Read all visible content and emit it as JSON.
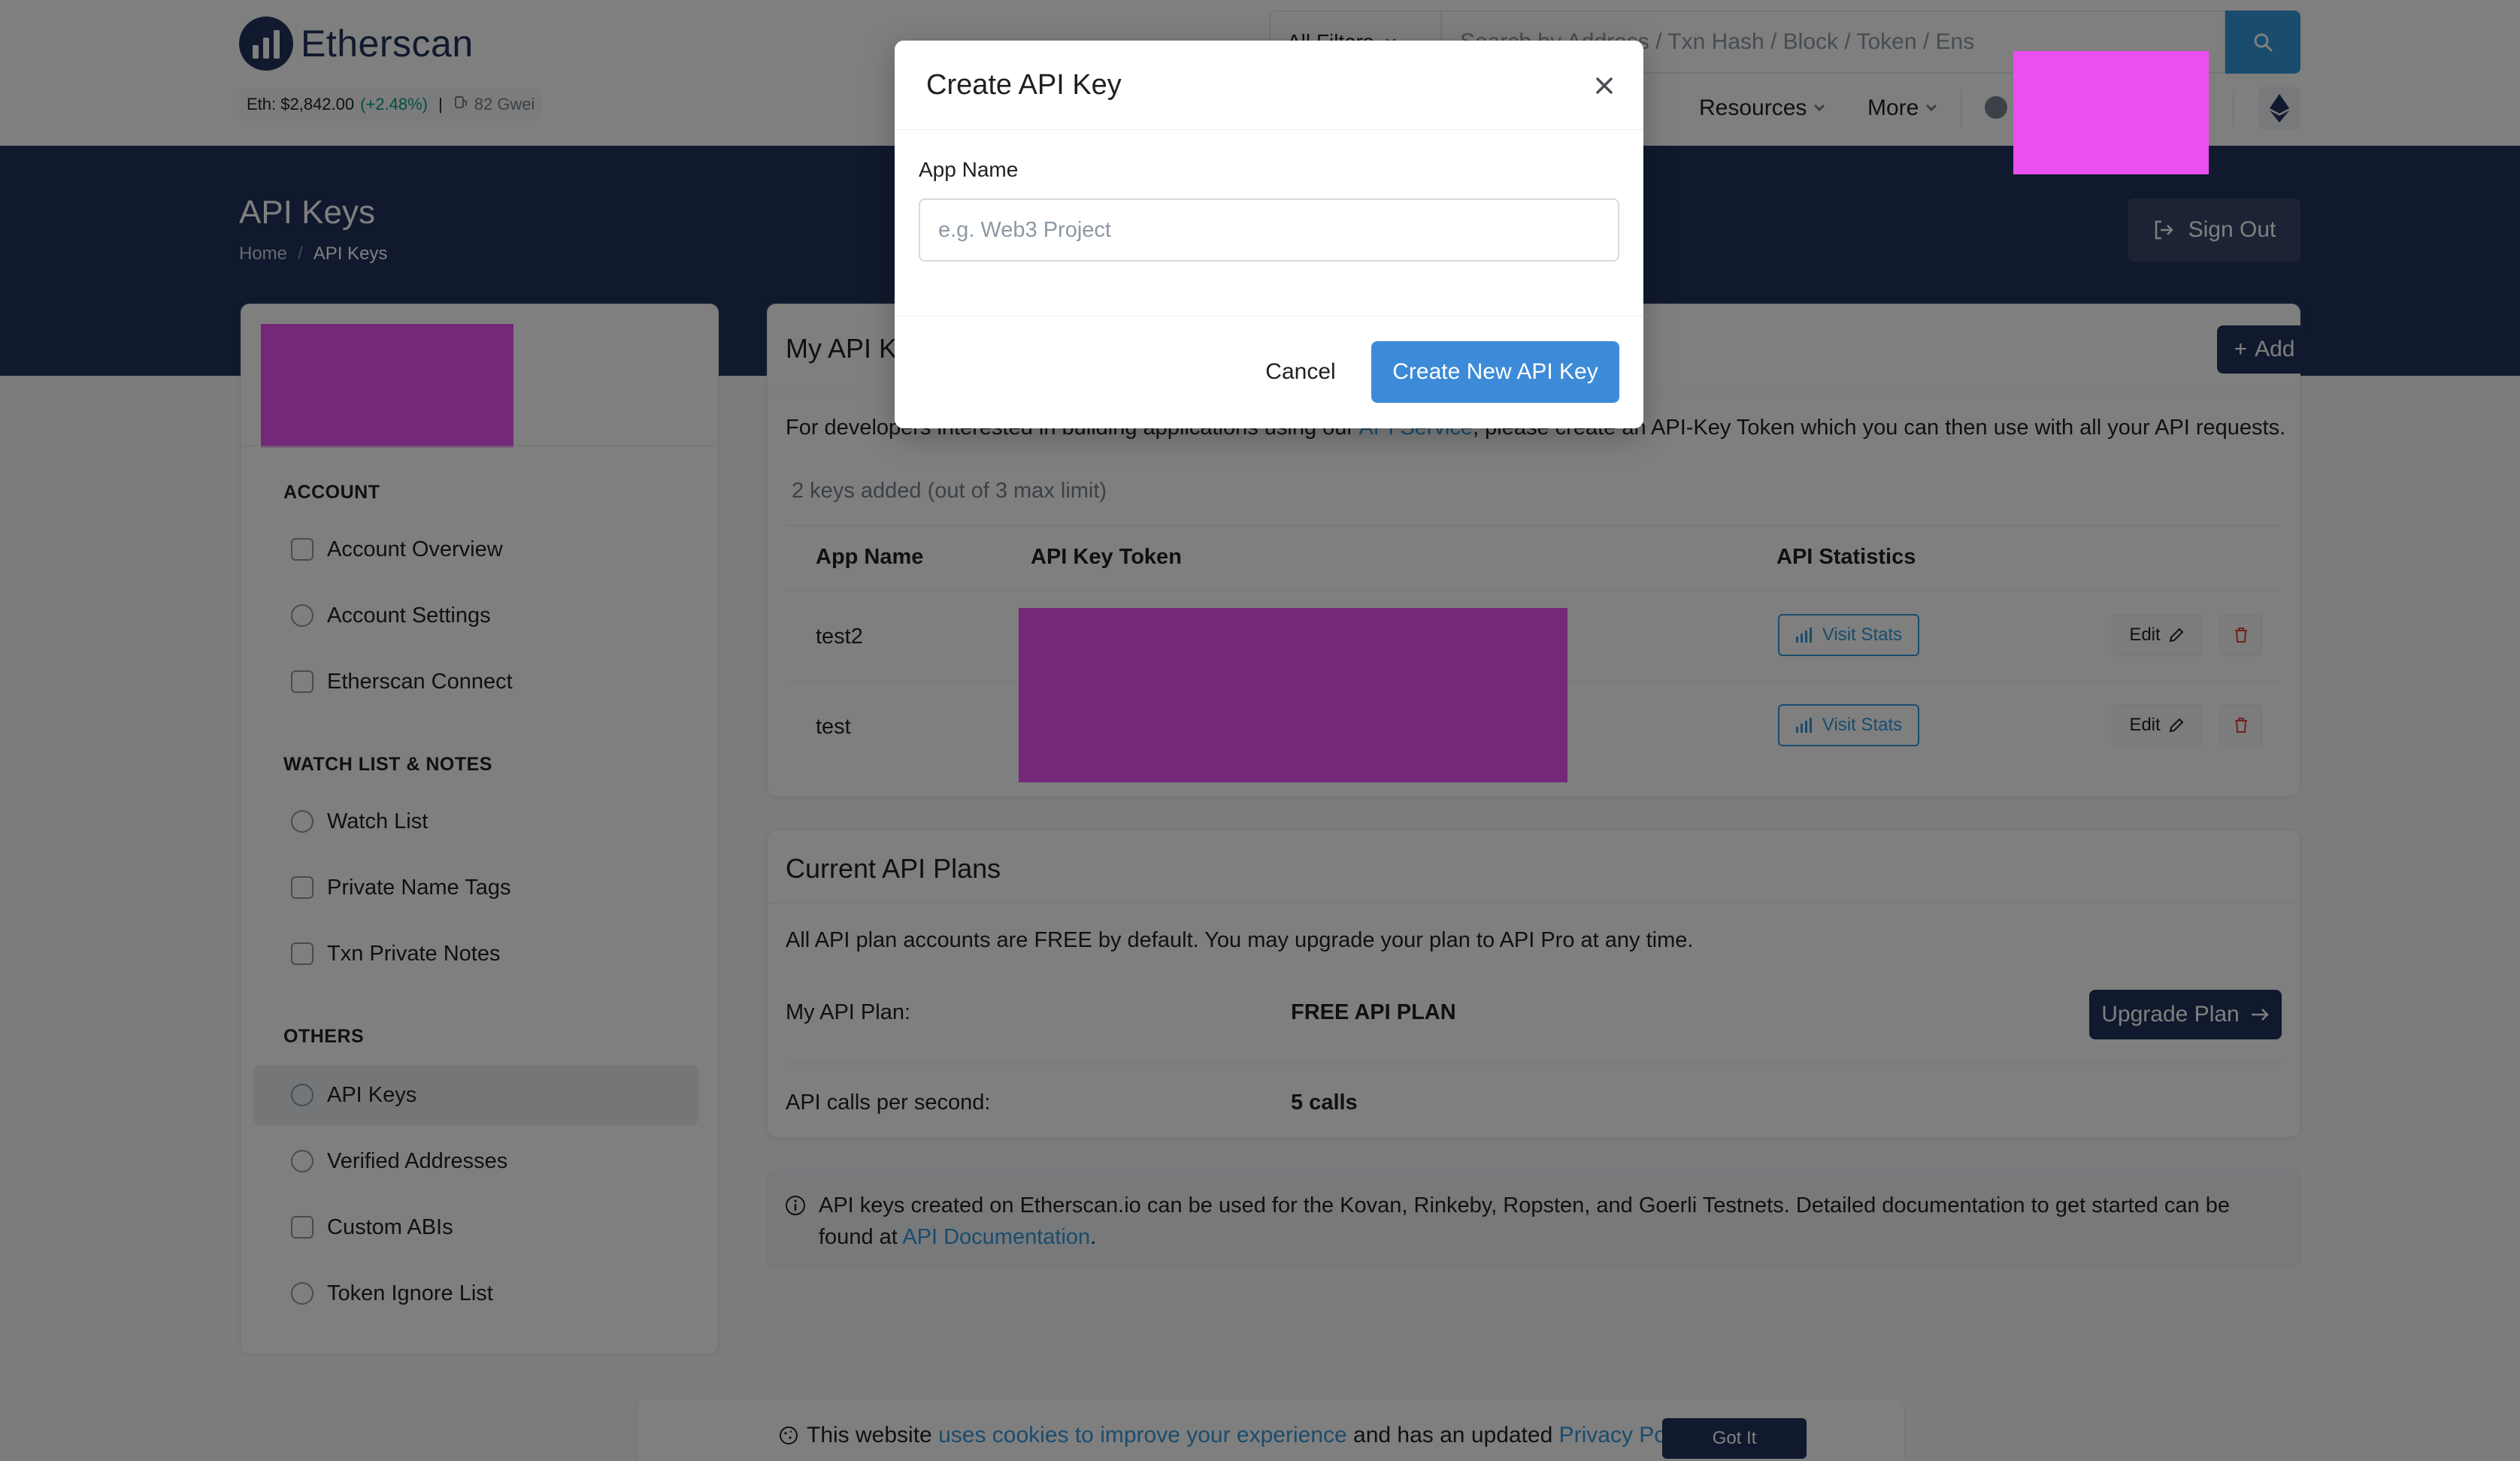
{
  "header": {
    "logo_text": "Etherscan",
    "eth_price_label": "Eth: $2,842.00",
    "eth_change": "(+2.48%)",
    "separator": "|",
    "gas": "82 Gwei",
    "filter_label": "All Filters",
    "search_placeholder": "Search by Address / Txn Hash / Block / Token / Ens",
    "nav": {
      "resources": "Resources",
      "more": "More"
    }
  },
  "hero": {
    "title": "API Keys",
    "breadcrumb_home": "Home",
    "breadcrumb_sep": "/",
    "breadcrumb_current": "API Keys",
    "sign_out": "Sign Out"
  },
  "sidebar": {
    "sections": [
      {
        "title": "ACCOUNT"
      },
      {
        "title": "WATCH LIST & NOTES"
      },
      {
        "title": "OTHERS"
      }
    ],
    "items": [
      {
        "label": "Account Overview",
        "icon": "home-icon"
      },
      {
        "label": "Account Settings",
        "icon": "user-settings-icon"
      },
      {
        "label": "Etherscan Connect",
        "icon": "gift-icon"
      },
      {
        "label": "Watch List",
        "icon": "heart-icon"
      },
      {
        "label": "Private Name Tags",
        "icon": "tag-icon"
      },
      {
        "label": "Txn Private Notes",
        "icon": "file-icon"
      },
      {
        "label": "API Keys",
        "icon": "key-icon",
        "active": true
      },
      {
        "label": "Verified Addresses",
        "icon": "check-circle-icon"
      },
      {
        "label": "Custom ABIs",
        "icon": "list-icon"
      },
      {
        "label": "Token Ignore List",
        "icon": "eye-slash-icon"
      }
    ]
  },
  "api_keys": {
    "title": "My API Keys",
    "add_label": "Add",
    "desc_before": "For developers interested in building applications using our ",
    "desc_link": "API Service",
    "desc_after": ", please create an API-Key Token which you can then use with all your API requests.",
    "count_text": "2 keys added (out of 3 max limit)",
    "columns": [
      "App Name",
      "API Key Token",
      "API Statistics"
    ],
    "rows": [
      {
        "app_name": "test2",
        "stats_label": "Visit Stats",
        "edit_label": "Edit"
      },
      {
        "app_name": "test",
        "stats_label": "Visit Stats",
        "edit_label": "Edit"
      }
    ]
  },
  "plans": {
    "title": "Current API Plans",
    "desc": "All API plan accounts are FREE by default. You may upgrade your plan to API Pro at any time.",
    "plan_label": "My API Plan:",
    "plan_value": "FREE API PLAN",
    "upgrade_label": "Upgrade Plan",
    "calls_label": "API calls per second:",
    "calls_value": "5 calls"
  },
  "info": {
    "text": "API keys created on Etherscan.io can be used for the Kovan, Rinkeby, Ropsten, and Goerli Testnets. Detailed documentation to get started can be found at ",
    "link": "API Documentation",
    "end": "."
  },
  "modal": {
    "title": "Create API Key",
    "label": "App Name",
    "placeholder": "e.g. Web3 Project",
    "value": "",
    "cancel": "Cancel",
    "create": "Create New API Key"
  },
  "cookie": {
    "text_before": "This website ",
    "link1": "uses cookies to improve your experience",
    "text_mid": " and has an updated ",
    "link2": "Privacy Policy",
    "text_end": ".",
    "button": "Got It"
  },
  "colors": {
    "primary": "#3498db",
    "navy": "#21325b",
    "redaction": "#ea4ff0",
    "positive": "#00a186",
    "danger": "#de4437"
  }
}
